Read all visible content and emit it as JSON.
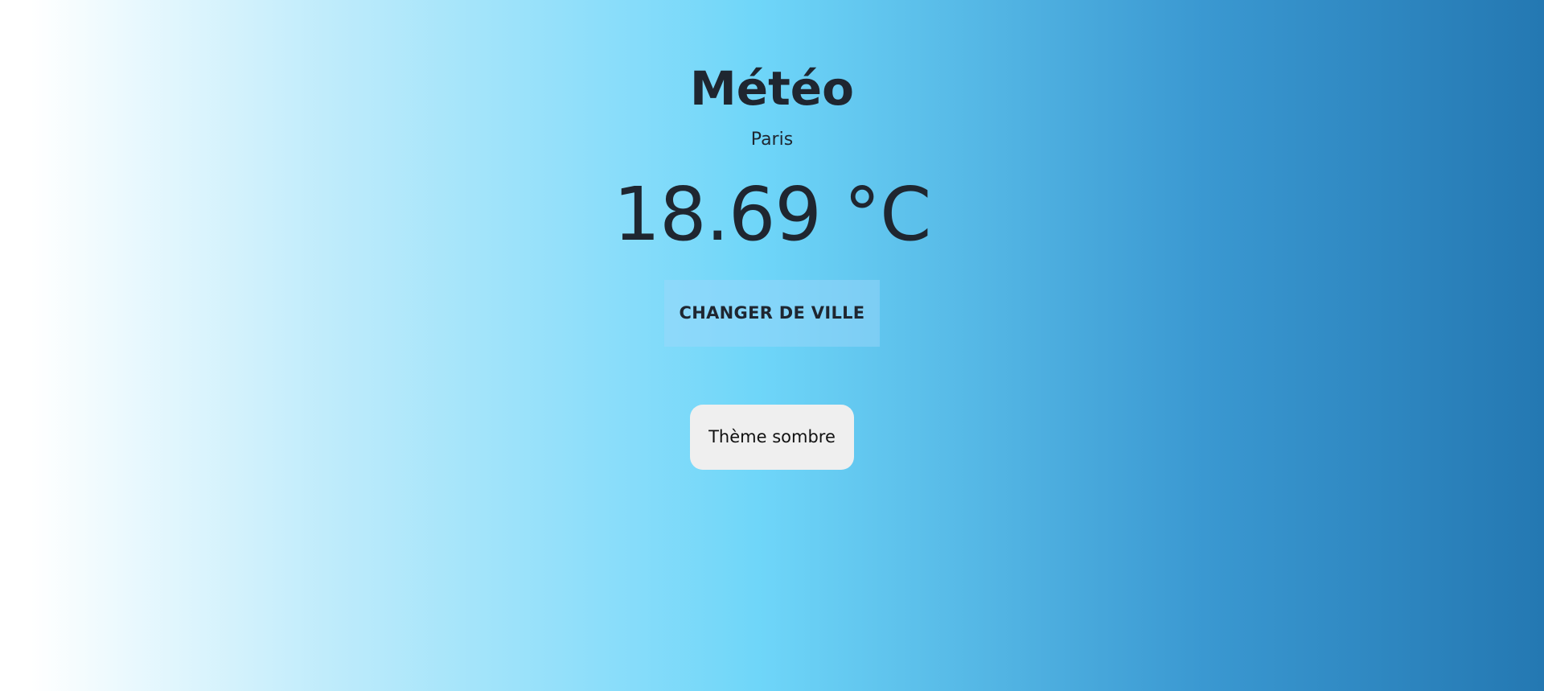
{
  "weather": {
    "title": "Météo",
    "city": "Paris",
    "temperature": "18.69 °C",
    "change_city_label": "CHANGER DE VILLE"
  },
  "theme": {
    "toggle_label": "Thème sombre"
  },
  "colors": {
    "gradient_start": "#ffffff",
    "gradient_mid": "#6fd6f9",
    "gradient_end": "#2478b2",
    "text": "#1f2630",
    "theme_button_bg": "#efefef"
  }
}
